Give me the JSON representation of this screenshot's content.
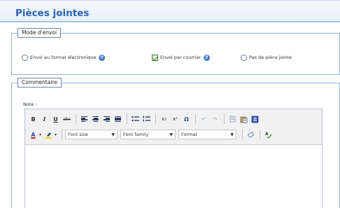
{
  "page": {
    "title": "Pièces jointes"
  },
  "mode_envoi": {
    "legend": "Mode d'envoi",
    "options": [
      {
        "label": "Envoi au format électronique",
        "control": "radio",
        "selected": false,
        "has_help": true
      },
      {
        "label": "Envoi par courrier",
        "control": "checkbox",
        "selected": true,
        "has_help": true
      },
      {
        "label": "Pas de pièce jointe",
        "control": "radio",
        "selected": false,
        "has_help": false
      }
    ]
  },
  "commentaire": {
    "legend": "Commentaire",
    "note_label": "Note :",
    "toolbar": {
      "row1": [
        "bold",
        "italic",
        "underline",
        "strikethrough",
        "align-left",
        "align-center",
        "align-right",
        "align-justify",
        "bullet-list",
        "numbered-list",
        "subscript",
        "superscript",
        "special-char",
        "undo",
        "redo",
        "cut",
        "paste-text",
        "paste-word"
      ],
      "row2": [
        "font-color",
        "highlight-color",
        "font-size",
        "font-family",
        "format",
        "remove-format",
        "spellcheck"
      ],
      "bold_glyph": "B",
      "italic_glyph": "I",
      "underline_glyph": "U",
      "strike_glyph": "abc",
      "subscript_glyph": "x₂",
      "superscript_glyph": "x²",
      "omega_glyph": "Ω",
      "undo_glyph": "↶",
      "redo_glyph": "↷",
      "font_color_glyph": "A",
      "font_size_label": "Font size",
      "font_family_label": "Font family",
      "format_label": "Format"
    }
  },
  "colors": {
    "title": "#2a63b3",
    "border": "#8fb3de",
    "help": "#2457a8",
    "check": "#2e8b1f"
  }
}
